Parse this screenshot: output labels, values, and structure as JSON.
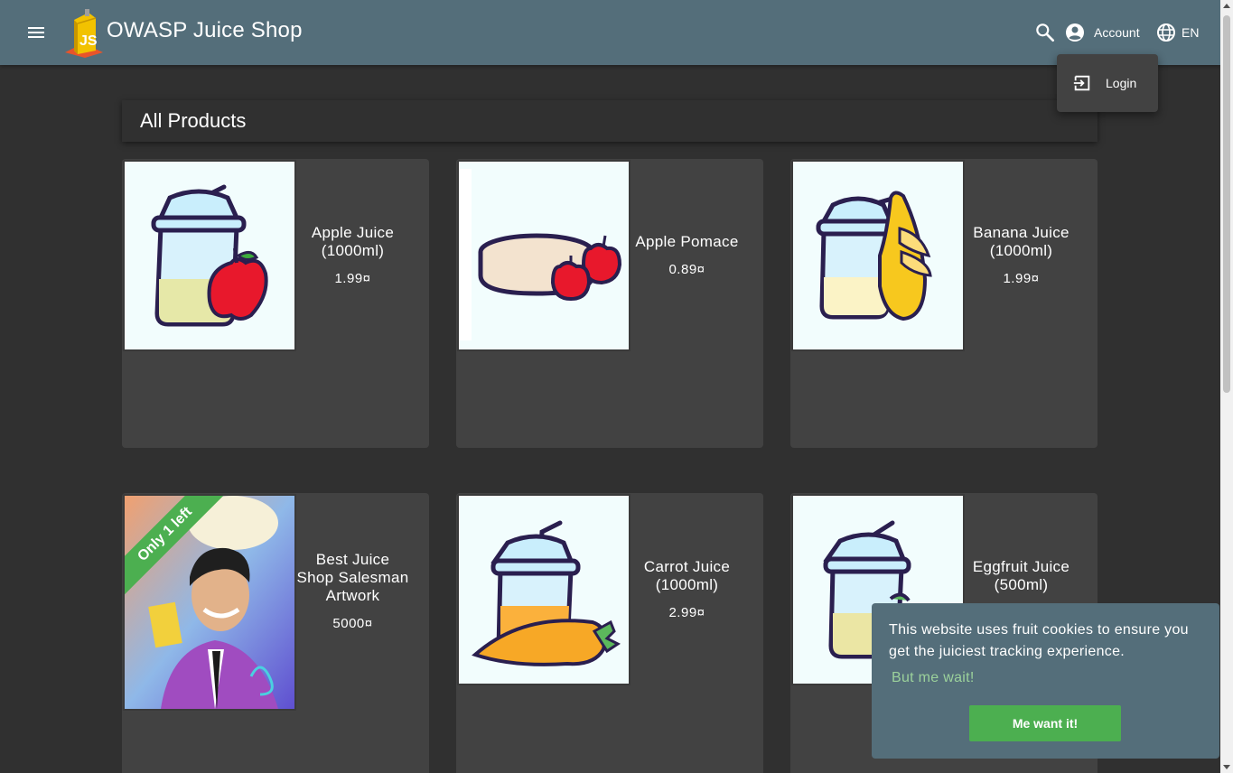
{
  "app": {
    "title": "OWASP Juice Shop"
  },
  "toolbar": {
    "menu_icon": "menu-icon",
    "search_icon": "search-icon",
    "account_label": "Account",
    "account_icon": "account-circle-icon",
    "language_label": "EN",
    "language_icon": "globe-icon"
  },
  "account_menu": {
    "items": [
      {
        "label": "Login",
        "icon": "login-icon"
      }
    ]
  },
  "main": {
    "heading": "All Products"
  },
  "products": [
    {
      "name": "Apple Juice (1000ml)",
      "price": "1.99¤"
    },
    {
      "name": "Apple Pomace",
      "price": "0.89¤"
    },
    {
      "name": "Banana Juice (1000ml)",
      "price": "1.99¤"
    },
    {
      "name": "Best Juice Shop Salesman Artwork",
      "price": "5000¤",
      "badge": "Only 1 left"
    },
    {
      "name": "Carrot Juice (1000ml)",
      "price": "2.99¤"
    },
    {
      "name": "Eggfruit Juice (500ml)",
      "price": ""
    }
  ],
  "cookie_banner": {
    "message": "This website uses fruit cookies to ensure you get the juiciest tracking experience.",
    "link": "But me wait!",
    "button": "Me want it!"
  },
  "colors": {
    "toolbar": "#546e7a",
    "background": "#303030",
    "card": "#424242",
    "accent": "#4caf50"
  }
}
